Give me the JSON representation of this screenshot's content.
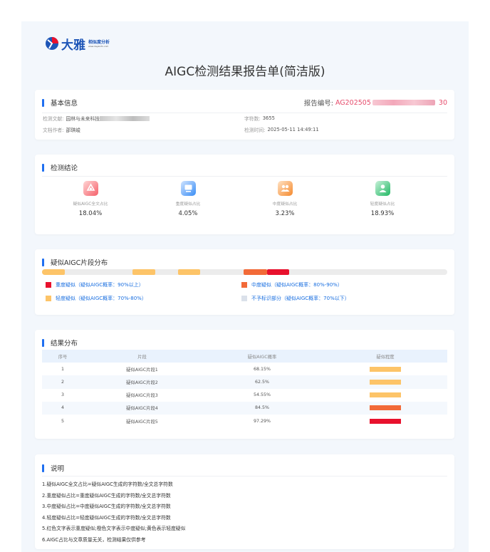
{
  "logo": {
    "name": "大雅",
    "subtitle": "相似度分析",
    "url_text": "www.dayainfo.com"
  },
  "title": "AIGC检测结果报告单(简洁版)",
  "basic": {
    "section_title": "基本信息",
    "report_no_label": "报告编号:",
    "report_no_prefix": "AG202505",
    "report_no_suffix": "30",
    "doc_label": "检测文献:",
    "doc_value": "园林与未来科技",
    "author_label": "文档作者:",
    "author_value": "邵琪峻",
    "chars_label": "字符数:",
    "chars_value": "3655",
    "time_label": "检测时间:",
    "time_value": "2025-05-11 14:49:11"
  },
  "conclusion": {
    "section_title": "检测结论",
    "stats": [
      {
        "label": "疑似AIGC全文占比",
        "value": "18.04%",
        "icon": "document-ai-icon",
        "color": "#f5606a"
      },
      {
        "label": "重度疑似占比",
        "value": "4.05%",
        "icon": "monitor-icon",
        "color": "#3a8ef5"
      },
      {
        "label": "中度疑似占比",
        "value": "3.23%",
        "icon": "user-group-icon",
        "color": "#f58a2e"
      },
      {
        "label": "轻度疑似占比",
        "value": "18.93%",
        "icon": "user-icon",
        "color": "#22b864"
      }
    ]
  },
  "distribution": {
    "section_title": "疑似AIGC片段分布",
    "colors": {
      "heavy": "#e8112d",
      "medium": "#f26a38",
      "light": "#fdc468",
      "none": "#dbe1ea"
    },
    "segments": [
      {
        "start": 0.0,
        "end": 0.056,
        "level": "light"
      },
      {
        "start": 0.223,
        "end": 0.279,
        "level": "light"
      },
      {
        "start": 0.335,
        "end": 0.39,
        "level": "light"
      },
      {
        "start": 0.498,
        "end": 0.555,
        "level": "medium"
      },
      {
        "start": 0.555,
        "end": 0.61,
        "level": "heavy"
      }
    ],
    "legend": [
      {
        "text": "重度疑似（疑似AIGC概率：90%以上）",
        "level": "heavy"
      },
      {
        "text": "中度疑似（疑似AIGC概率：80%-90%）",
        "level": "medium"
      },
      {
        "text": "轻度疑似（疑似AIGC概率：70%-80%）",
        "level": "light"
      },
      {
        "text": "不予标识部分（疑似AIGC概率：70%以下）",
        "level": "none"
      }
    ]
  },
  "results": {
    "section_title": "结果分布",
    "headers": [
      "序号",
      "片段",
      "疑似AIGC概率",
      "疑似程度"
    ],
    "rows": [
      {
        "no": "1",
        "name": "疑似AIGC片段1",
        "prob": "68.15%",
        "level": "light"
      },
      {
        "no": "2",
        "name": "疑似AIGC片段2",
        "prob": "62.5%",
        "level": "light"
      },
      {
        "no": "3",
        "name": "疑似AIGC片段3",
        "prob": "54.55%",
        "level": "light"
      },
      {
        "no": "4",
        "name": "疑似AIGC片段4",
        "prob": "84.5%",
        "level": "medium"
      },
      {
        "no": "5",
        "name": "疑似AIGC片段5",
        "prob": "97.29%",
        "level": "heavy"
      }
    ]
  },
  "notes": {
    "section_title": "说明",
    "items": [
      "1.疑似AIGC全文占比=疑似AIGC生成的字符数/全文总字符数",
      "2.重度疑似占比=重度疑似AIGC生成的字符数/全文总字符数",
      "3.中度疑似占比=中度疑似AIGC生成的字符数/全文总字符数",
      "4.轻度疑似占比=轻度疑似AIGC生成的字符数/全文总字符数",
      "5.红色文字表示重度疑似;橙色文字表示中度疑似;黄色表示轻度疑似",
      "6.AIGC占比与文章质量无关，检测结果仅供参考"
    ]
  }
}
